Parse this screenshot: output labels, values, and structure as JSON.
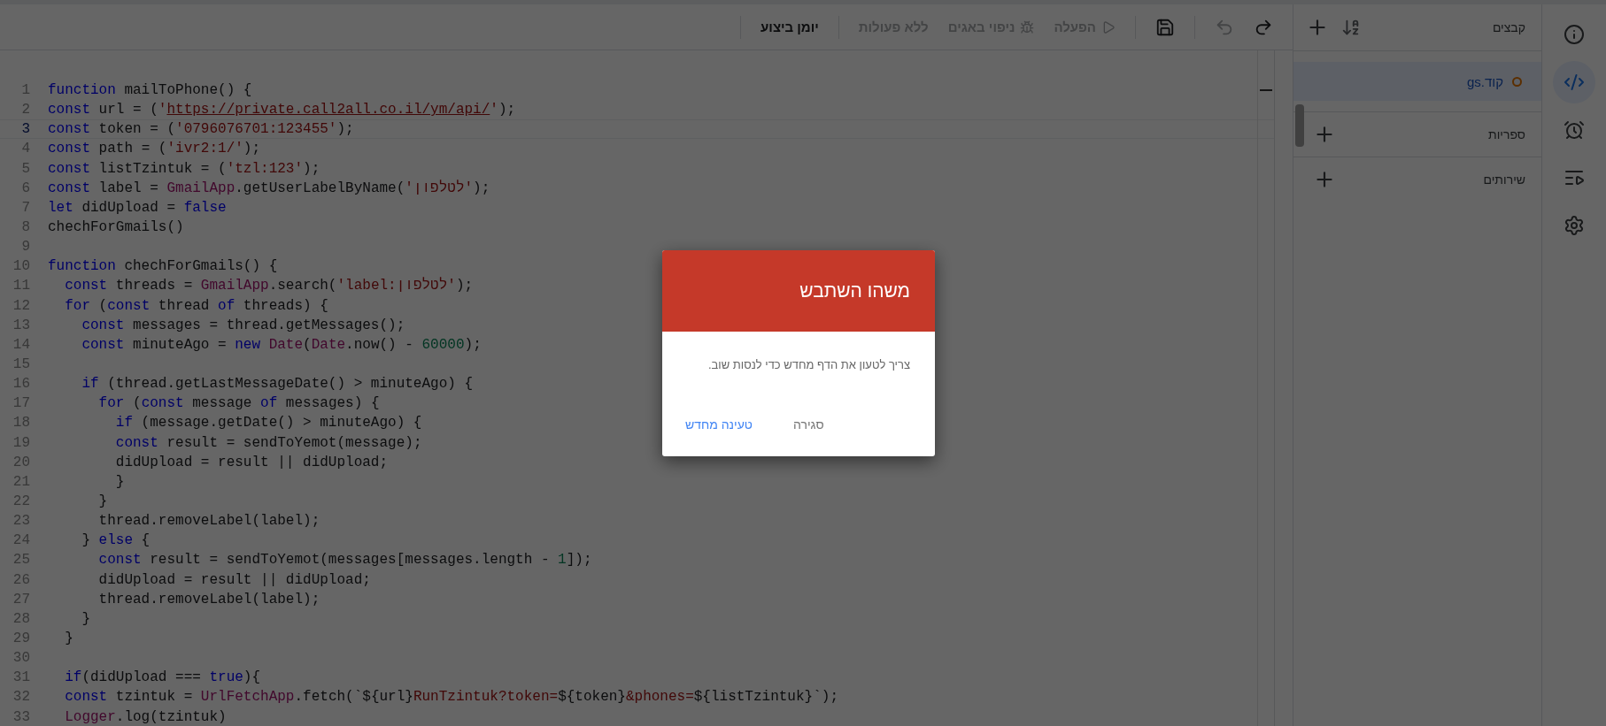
{
  "toolbar": {
    "redo": {
      "disabled": false
    },
    "undo": {
      "disabled": true
    },
    "run": {
      "label": "הפעלה",
      "disabled": true
    },
    "debug": {
      "label": "ניפוי באגים",
      "disabled": true
    },
    "function_select": {
      "label": "ללא פעולות",
      "disabled": true
    },
    "execution_log": {
      "label": "יומן ביצוע"
    }
  },
  "editor": {
    "lines": [
      {
        "number": "1",
        "current": false,
        "tokens": [
          {
            "kind": "keyword",
            "text": "function"
          },
          {
            "kind": "plain",
            "text": " mailToPhone() {"
          }
        ]
      },
      {
        "number": "2",
        "current": false,
        "tokens": [
          {
            "kind": "keyword",
            "text": "const"
          },
          {
            "kind": "plain",
            "text": " url = ("
          },
          {
            "kind": "string",
            "text": "'"
          },
          {
            "kind": "url",
            "text": "https://private.call2all.co.il/ym/api/"
          },
          {
            "kind": "string",
            "text": "'"
          },
          {
            "kind": "plain",
            "text": ");"
          }
        ]
      },
      {
        "number": "3",
        "current": true,
        "tokens": [
          {
            "kind": "keyword",
            "text": "const"
          },
          {
            "kind": "plain",
            "text": " token = ("
          },
          {
            "kind": "string",
            "text": "'0796076701:123455'"
          },
          {
            "kind": "plain",
            "text": ");"
          }
        ]
      },
      {
        "number": "4",
        "current": false,
        "tokens": [
          {
            "kind": "keyword",
            "text": "const"
          },
          {
            "kind": "plain",
            "text": " path = ("
          },
          {
            "kind": "string",
            "text": "'ivr2:1/'"
          },
          {
            "kind": "plain",
            "text": ");"
          }
        ]
      },
      {
        "number": "5",
        "current": false,
        "tokens": [
          {
            "kind": "keyword",
            "text": "const"
          },
          {
            "kind": "plain",
            "text": " listTzintuk = ("
          },
          {
            "kind": "string",
            "text": "'tzl:123'"
          },
          {
            "kind": "plain",
            "text": ");"
          }
        ]
      },
      {
        "number": "6",
        "current": false,
        "tokens": [
          {
            "kind": "keyword",
            "text": "const"
          },
          {
            "kind": "plain",
            "text": " label = "
          },
          {
            "kind": "class",
            "text": "GmailApp"
          },
          {
            "kind": "plain",
            "text": ".getUserLabelByName("
          },
          {
            "kind": "string",
            "text": "'לטלפון'"
          },
          {
            "kind": "plain",
            "text": ");"
          }
        ]
      },
      {
        "number": "7",
        "current": false,
        "tokens": [
          {
            "kind": "keyword",
            "text": "let"
          },
          {
            "kind": "plain",
            "text": " didUpload = "
          },
          {
            "kind": "keyword",
            "text": "false"
          }
        ]
      },
      {
        "number": "8",
        "current": false,
        "tokens": [
          {
            "kind": "plain",
            "text": "chechForGmails()"
          }
        ]
      },
      {
        "number": "9",
        "current": false
      },
      {
        "number": "10",
        "current": false,
        "tokens": [
          {
            "kind": "keyword",
            "text": "function"
          },
          {
            "kind": "plain",
            "text": " chechForGmails() {"
          }
        ]
      },
      {
        "number": "11",
        "current": false,
        "tokens": [
          {
            "kind": "keyword",
            "text": "  const"
          },
          {
            "kind": "plain",
            "text": " threads = "
          },
          {
            "kind": "class",
            "text": "GmailApp"
          },
          {
            "kind": "plain",
            "text": ".search("
          },
          {
            "kind": "string",
            "text": "'label:לטלפון'"
          },
          {
            "kind": "plain",
            "text": ");"
          }
        ]
      },
      {
        "number": "12",
        "current": false,
        "tokens": [
          {
            "kind": "keyword",
            "text": "  for"
          },
          {
            "kind": "plain",
            "text": " ("
          },
          {
            "kind": "keyword",
            "text": "const"
          },
          {
            "kind": "plain",
            "text": " thread "
          },
          {
            "kind": "keyword",
            "text": "of"
          },
          {
            "kind": "plain",
            "text": " threads) {"
          }
        ]
      },
      {
        "number": "13",
        "current": false,
        "tokens": [
          {
            "kind": "keyword",
            "text": "    const"
          },
          {
            "kind": "plain",
            "text": " messages = thread.getMessages();"
          }
        ]
      },
      {
        "number": "14",
        "current": false,
        "tokens": [
          {
            "kind": "keyword",
            "text": "    const"
          },
          {
            "kind": "plain",
            "text": " minuteAgo = "
          },
          {
            "kind": "keyword",
            "text": "new"
          },
          {
            "kind": "class",
            "text": " Date"
          },
          {
            "kind": "plain",
            "text": "("
          },
          {
            "kind": "class",
            "text": "Date"
          },
          {
            "kind": "plain",
            "text": ".now() - "
          },
          {
            "kind": "number",
            "text": "60000"
          },
          {
            "kind": "plain",
            "text": ");"
          }
        ]
      },
      {
        "number": "15",
        "current": false
      },
      {
        "number": "16",
        "current": false,
        "tokens": [
          {
            "kind": "keyword",
            "text": "    if"
          },
          {
            "kind": "plain",
            "text": " (thread.getLastMessageDate() > minuteAgo) {"
          }
        ]
      },
      {
        "number": "17",
        "current": false,
        "tokens": [
          {
            "kind": "keyword",
            "text": "      for"
          },
          {
            "kind": "plain",
            "text": " ("
          },
          {
            "kind": "keyword",
            "text": "const"
          },
          {
            "kind": "plain",
            "text": " message "
          },
          {
            "kind": "keyword",
            "text": "of"
          },
          {
            "kind": "plain",
            "text": " messages) {"
          }
        ]
      },
      {
        "number": "18",
        "current": false,
        "tokens": [
          {
            "kind": "keyword",
            "text": "        if"
          },
          {
            "kind": "plain",
            "text": " (message.getDate() > minuteAgo) {"
          }
        ]
      },
      {
        "number": "19",
        "current": false,
        "tokens": [
          {
            "kind": "keyword",
            "text": "        const"
          },
          {
            "kind": "plain",
            "text": " result = sendToYemot(message);"
          }
        ]
      },
      {
        "number": "20",
        "current": false,
        "tokens": [
          {
            "kind": "plain",
            "text": "        didUpload = result || didUpload;"
          }
        ]
      },
      {
        "number": "21",
        "current": false,
        "tokens": [
          {
            "kind": "plain",
            "text": "        }"
          }
        ]
      },
      {
        "number": "22",
        "current": false,
        "tokens": [
          {
            "kind": "plain",
            "text": "      }"
          }
        ]
      },
      {
        "number": "23",
        "current": false,
        "tokens": [
          {
            "kind": "plain",
            "text": "      thread.removeLabel(label);"
          }
        ]
      },
      {
        "number": "24",
        "current": false,
        "tokens": [
          {
            "kind": "plain",
            "text": "    } "
          },
          {
            "kind": "keyword",
            "text": "else"
          },
          {
            "kind": "plain",
            "text": " {"
          }
        ]
      },
      {
        "number": "25",
        "current": false,
        "tokens": [
          {
            "kind": "keyword",
            "text": "      const"
          },
          {
            "kind": "plain",
            "text": " result = sendToYemot(messages[messages.length - "
          },
          {
            "kind": "number",
            "text": "1"
          },
          {
            "kind": "plain",
            "text": "]);"
          }
        ]
      },
      {
        "number": "26",
        "current": false,
        "tokens": [
          {
            "kind": "plain",
            "text": "      didUpload = result || didUpload;"
          }
        ]
      },
      {
        "number": "27",
        "current": false,
        "tokens": [
          {
            "kind": "plain",
            "text": "      thread.removeLabel(label);"
          }
        ]
      },
      {
        "number": "28",
        "current": false,
        "tokens": [
          {
            "kind": "plain",
            "text": "    }"
          }
        ]
      },
      {
        "number": "29",
        "current": false,
        "tokens": [
          {
            "kind": "plain",
            "text": "  }"
          }
        ]
      },
      {
        "number": "30",
        "current": false
      },
      {
        "number": "31",
        "current": false,
        "tokens": [
          {
            "kind": "keyword",
            "text": "  if"
          },
          {
            "kind": "plain",
            "text": "(didUpload === "
          },
          {
            "kind": "keyword",
            "text": "true"
          },
          {
            "kind": "plain",
            "text": "){"
          }
        ]
      },
      {
        "number": "32",
        "current": false,
        "tokens": [
          {
            "kind": "keyword",
            "text": "  const"
          },
          {
            "kind": "plain",
            "text": " tzintuk = "
          },
          {
            "kind": "class",
            "text": "UrlFetchApp"
          },
          {
            "kind": "plain",
            "text": ".fetch(`${url}"
          },
          {
            "kind": "string",
            "text": "RunTzintuk?token="
          },
          {
            "kind": "plain",
            "text": "${token}"
          },
          {
            "kind": "string",
            "text": "&phones="
          },
          {
            "kind": "plain",
            "text": "${listTzintuk}`);"
          }
        ]
      },
      {
        "number": "33",
        "current": false,
        "tokens": [
          {
            "kind": "class",
            "text": "  Logger"
          },
          {
            "kind": "plain",
            "text": ".log(tzintuk)"
          }
        ]
      }
    ]
  },
  "sidebar": {
    "files_title": "קבצים",
    "files": [
      {
        "name": "קוד.gs",
        "selected": true,
        "unsaved": true
      }
    ],
    "sections": [
      {
        "title": "ספריות"
      },
      {
        "title": "שירותים"
      }
    ]
  },
  "rail": [
    {
      "selected": false
    },
    {
      "selected": true
    },
    {
      "selected": false
    },
    {
      "selected": false
    },
    {
      "selected": false
    }
  ],
  "dialog": {
    "title": "משהו השתבש",
    "message": "צריך לטעון את הדף מחדש כדי לנסות שוב.",
    "buttons": [
      {
        "label": "סגירה",
        "kind": "secondary"
      },
      {
        "label": "טעינה מחדש",
        "kind": "primary"
      }
    ]
  }
}
